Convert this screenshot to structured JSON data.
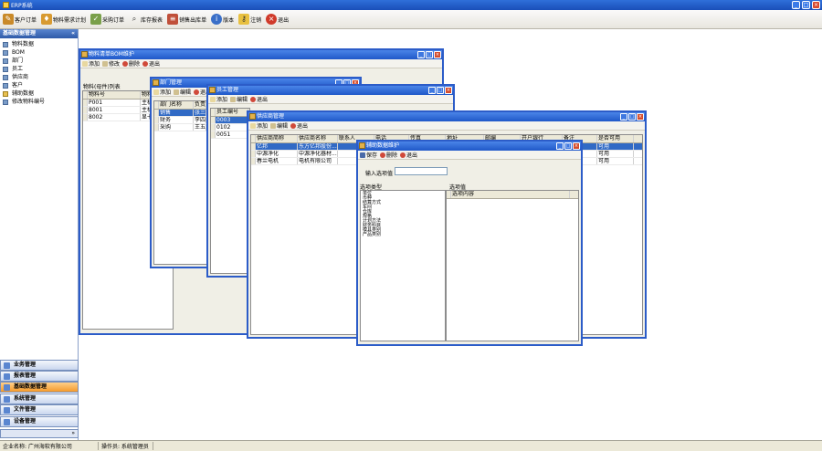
{
  "app": {
    "title": "ERP系统"
  },
  "toolbar": [
    "客户订单",
    "物料需求计划",
    "采购订单",
    "库存报表",
    "销售出库单",
    "版本",
    "注销",
    "退出"
  ],
  "sidebar": {
    "title": "基础数据管理",
    "items": [
      "物料数据",
      "BOM",
      "部门",
      "员工",
      "供应商",
      "客户",
      "辅助数据",
      "修改物料编号"
    ],
    "accordion": [
      "业务管理",
      "报表管理",
      "基础数据管理",
      "系统管理",
      "文件管理",
      "设备管理"
    ]
  },
  "status": {
    "company": "企业名称: 广州海软有限公司",
    "operator": "操作员:  系统管理员"
  },
  "bom": {
    "title": "物料清单BOM维护",
    "tb": [
      "添加",
      "修改",
      "删除",
      "退出"
    ],
    "label": "物料(母件)列表",
    "cols": [
      "物料号",
      "物料"
    ],
    "rows": [
      [
        "P001",
        "主机"
      ],
      [
        "8001",
        "主机"
      ],
      [
        "8002",
        "显卡"
      ]
    ]
  },
  "dept": {
    "title": "部门管理",
    "tb": [
      "添加",
      "编辑",
      "退出"
    ],
    "cols": [
      "部门名称",
      "负责"
    ],
    "rows": [
      [
        "销售",
        "张三"
      ],
      [
        "财务",
        "李四"
      ],
      [
        "采购",
        "王五"
      ]
    ]
  },
  "emp": {
    "title": "员工管理",
    "tb": [
      "添加",
      "编辑",
      "退出"
    ],
    "cols": [
      "员工编号"
    ],
    "rows": [
      [
        "0003"
      ],
      [
        "0102"
      ],
      [
        "0051"
      ]
    ]
  },
  "sup": {
    "title": "供应商管理",
    "tb": [
      "添加",
      "编辑",
      "退出"
    ],
    "cols": [
      "供应商简称",
      "供应商名称",
      "联系人",
      "电话",
      "传真",
      "地址",
      "邮编",
      "开户银行",
      "备注",
      "是否可用"
    ],
    "rows": [
      [
        "亿邦",
        "东方亿邦股份...",
        "",
        "",
        "",
        "",
        "",
        "",
        "",
        "可用"
      ],
      [
        "中源净化",
        "中源净化器材...",
        "",
        "",
        "",
        "",
        "",
        "",
        "",
        "可用"
      ],
      [
        "春兰电机",
        "电机有限公司",
        "",
        "",
        "",
        "",
        "",
        "",
        "",
        "可用"
      ]
    ]
  },
  "aux": {
    "title": "辅助数据维护",
    "tb": [
      "保存",
      "删除",
      "退出"
    ],
    "input_label": "输入选项值",
    "type_label": "选项类型",
    "value_label": "选项值",
    "value_col": "选项内容",
    "types": [
      "单位",
      "币种",
      "结算方式",
      "车间",
      "仓库",
      "规格",
      "计划方法",
      "财务科目",
      "模具类别",
      "产品类别"
    ]
  },
  "colors": {
    "titlebar": "#2058c8",
    "selected": "#316ac5",
    "active_acc": "#f59a2a"
  }
}
